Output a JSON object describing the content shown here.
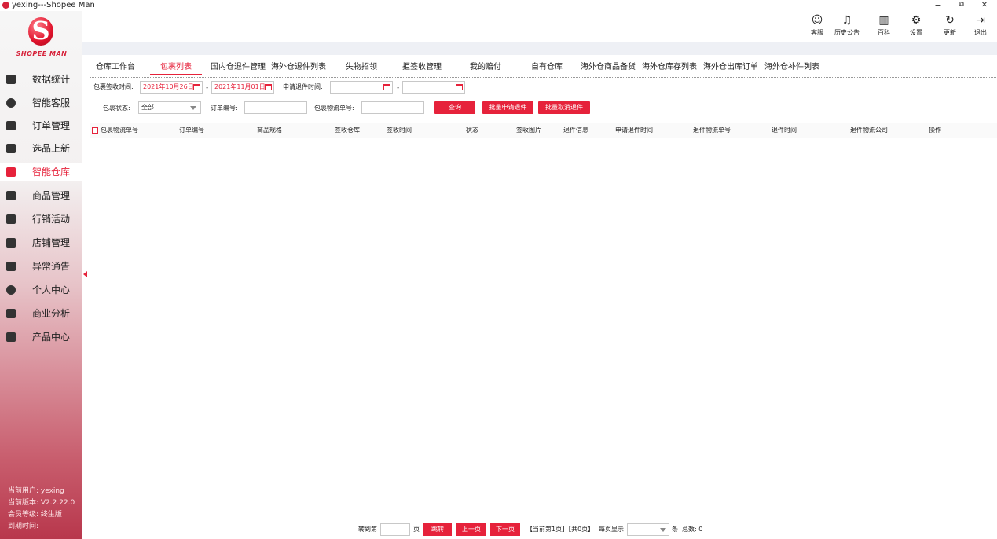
{
  "window": {
    "title": "yexing---Shopee Man",
    "minimize": "−",
    "restore": "⧉",
    "close": "✕"
  },
  "brand": {
    "logo_letter": "S",
    "name": "SHOPEE MAN"
  },
  "sidebar": {
    "items": [
      {
        "label": "数据统计",
        "icon": "monitor-icon"
      },
      {
        "label": "智能客服",
        "icon": "user-headset-icon"
      },
      {
        "label": "订单管理",
        "icon": "document-icon"
      },
      {
        "label": "选品上新",
        "icon": "cart-icon"
      },
      {
        "label": "智能仓库",
        "icon": "warehouse-icon",
        "active": true
      },
      {
        "label": "商品管理",
        "icon": "bag-icon"
      },
      {
        "label": "行销活动",
        "icon": "list-icon"
      },
      {
        "label": "店铺管理",
        "icon": "store-icon"
      },
      {
        "label": "异常通告",
        "icon": "alert-icon"
      },
      {
        "label": "个人中心",
        "icon": "person-icon"
      },
      {
        "label": "商业分析",
        "icon": "chart-icon"
      },
      {
        "label": "产品中心",
        "icon": "product-icon"
      }
    ],
    "info": {
      "user": "当前用户:  yexing",
      "version": "当前版本:  V2.2.22.0",
      "level": "会员等级:  终生版",
      "expire": "到期时间:"
    }
  },
  "header": {
    "buttons": [
      {
        "label": "客服",
        "icon": "headset-icon",
        "glyph": "☺"
      },
      {
        "label": "历史公告",
        "icon": "bell-icon",
        "glyph": "♫"
      },
      {
        "label": "百科",
        "icon": "book-icon",
        "glyph": "▥"
      },
      {
        "label": "设置",
        "icon": "gear-icon",
        "glyph": "⚙"
      },
      {
        "label": "更新",
        "icon": "refresh-icon",
        "glyph": "↻"
      },
      {
        "label": "退出",
        "icon": "logout-icon",
        "glyph": "⇥"
      }
    ]
  },
  "tabs": [
    "仓库工作台",
    "包裹列表",
    "国内仓退件管理",
    "海外仓退件列表",
    "失物招领",
    "拒签收管理",
    "我的赔付",
    "自有仓库",
    "海外仓商品备货",
    "海外仓库存列表",
    "海外仓出库订单",
    "海外仓补件列表"
  ],
  "active_tab": "包裹列表",
  "filters": {
    "sign_time_label": "包裹签收时间:",
    "sign_start": "2021年10月26日",
    "sign_end": "2021年11月01日",
    "return_time_label": "申请退件时间:",
    "return_start": "",
    "return_end": "",
    "date_sep": "-",
    "status_label": "包裹状态:",
    "status_value": "全部",
    "order_label": "订单编号:",
    "order_value": "",
    "tracking_label": "包裹物流单号:",
    "tracking_value": "",
    "query_btn": "查询",
    "batch_return_btn": "批量申请退件",
    "batch_cancel_btn": "批量取消退件"
  },
  "table": {
    "columns": [
      "包裹物流单号",
      "订单编号",
      "商品规格",
      "签收仓库",
      "签收时间",
      "状态",
      "签收图片",
      "退件信息",
      "申请退件时间",
      "退件物流单号",
      "退件时间",
      "退件物流公司",
      "操作"
    ],
    "rows": []
  },
  "pagination": {
    "goto_label": "转到第",
    "page_unit": "页",
    "jump_btn": "跳转",
    "prev_btn": "上一页",
    "next_btn": "下一页",
    "status": "【当前第1页】【共0页】",
    "per_page_label": "每页显示",
    "per_page_value": "",
    "count_unit": "条",
    "total": "总数: 0"
  }
}
